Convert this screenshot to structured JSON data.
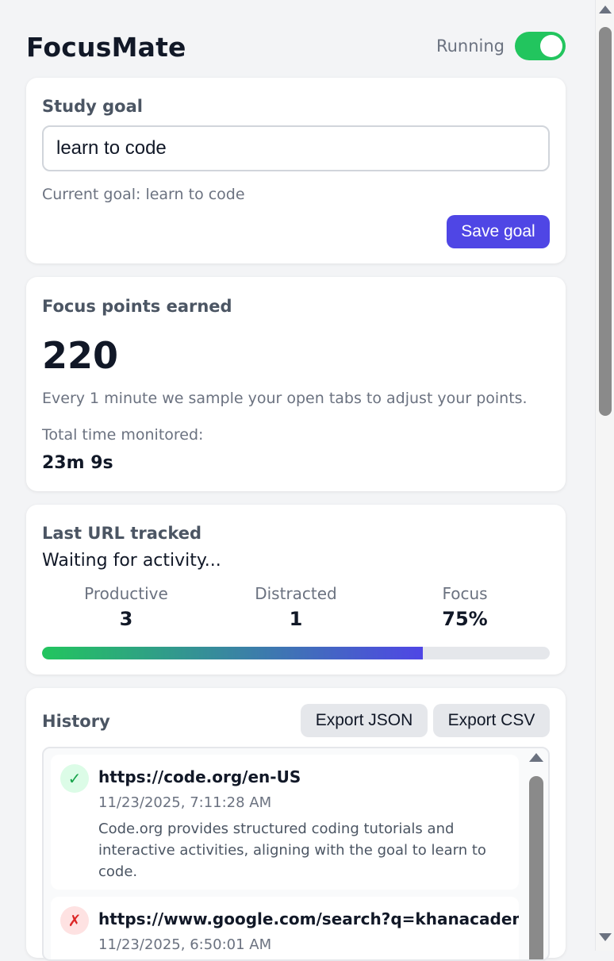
{
  "header": {
    "app_title": "FocusMate",
    "running_label": "Running",
    "running_on": true
  },
  "goal_card": {
    "title": "Study goal",
    "input_value": "learn to code",
    "current_goal_text": "Current goal: learn to code",
    "save_label": "Save goal"
  },
  "points_card": {
    "title": "Focus points earned",
    "points": "220",
    "description": "Every 1 minute we sample your open tabs to adjust your points.",
    "monitored_label": "Total time monitored:",
    "monitored_value": "23m 9s"
  },
  "stats_card": {
    "title": "Last URL tracked",
    "status_text": "Waiting for activity...",
    "stats": [
      {
        "label": "Productive",
        "value": "3"
      },
      {
        "label": "Distracted",
        "value": "1"
      },
      {
        "label": "Focus",
        "value": "75%"
      }
    ],
    "focus_fraction": 0.75
  },
  "history_card": {
    "title": "History",
    "export_json_label": "Export JSON",
    "export_csv_label": "Export CSV",
    "items": [
      {
        "status": "productive",
        "status_glyph": "✓",
        "url": "https://code.org/en-US",
        "timestamp": "11/23/2025, 7:11:28 AM",
        "description": "Code.org provides structured coding tutorials and interactive activities, aligning with the goal to learn to code."
      },
      {
        "status": "distracted",
        "status_glyph": "✗",
        "url": "https://www.google.com/search?q=khanacademy+math",
        "timestamp": "11/23/2025, 6:50:01 AM",
        "description": ""
      }
    ]
  },
  "colors": {
    "accent": "#4f46e5",
    "toggle_on": "#22c55e",
    "productive": "#16a34a",
    "distracted": "#dc2626"
  }
}
